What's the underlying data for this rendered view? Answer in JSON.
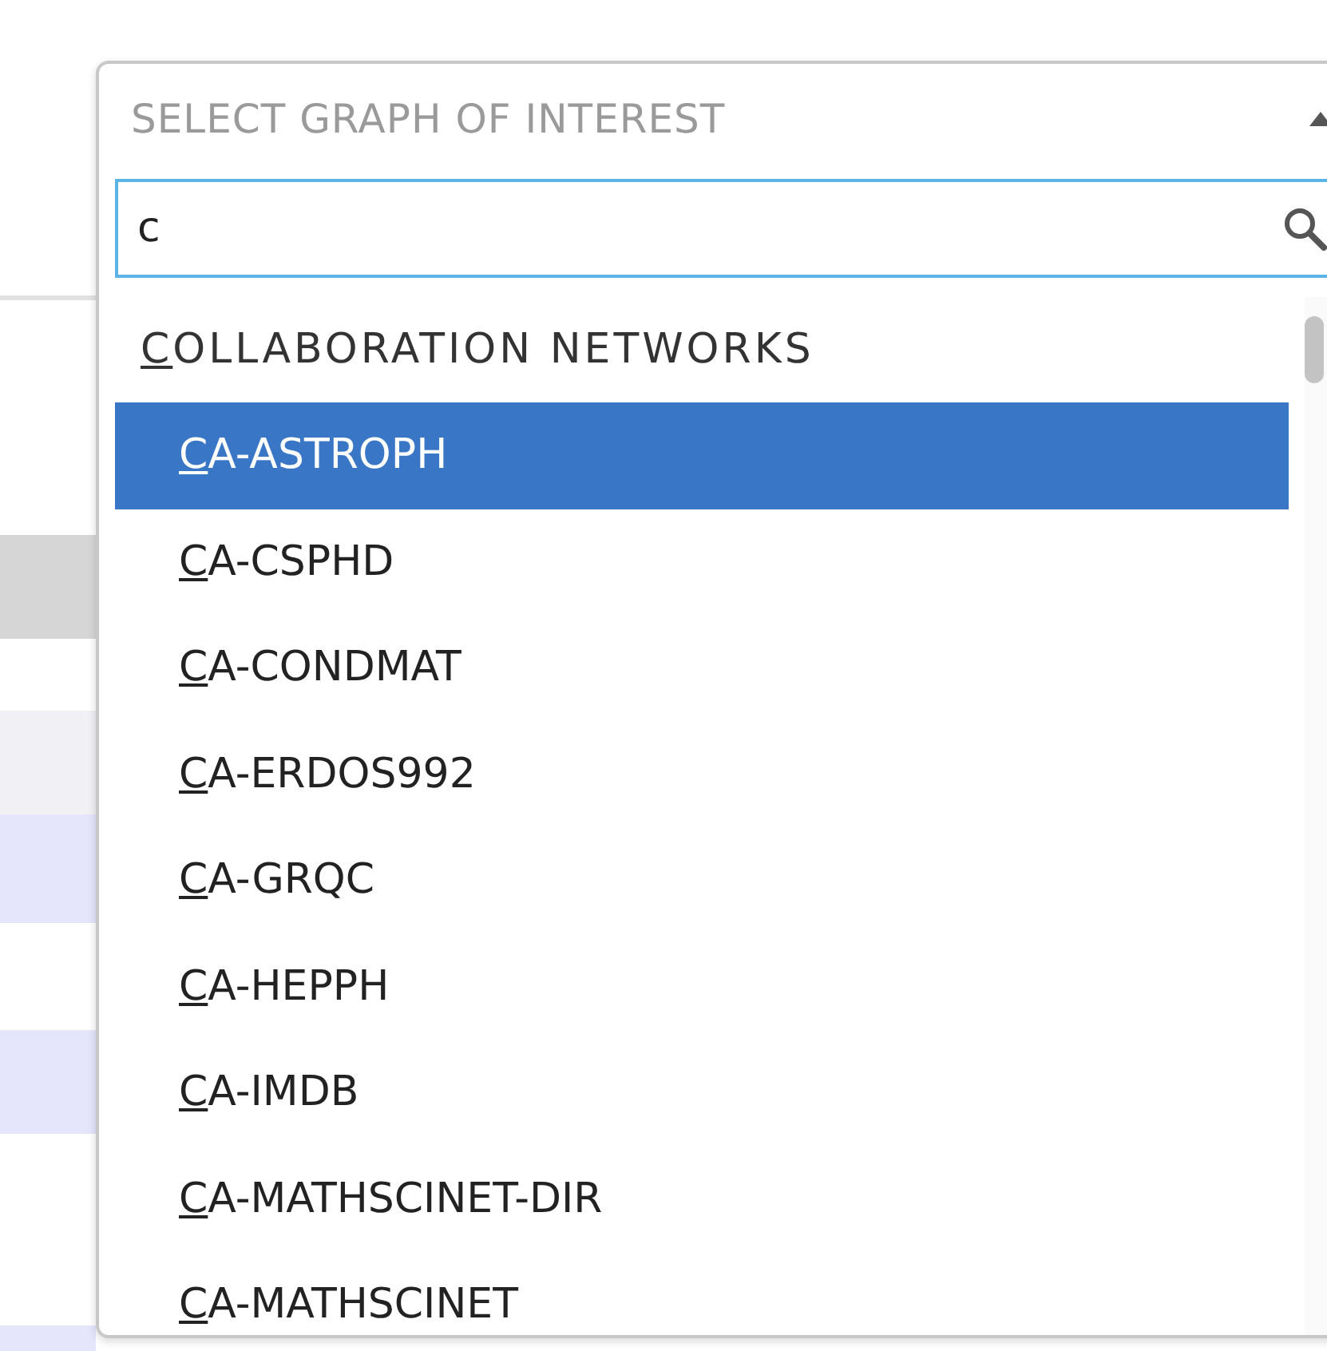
{
  "dropdown": {
    "placeholder": "SELECT GRAPH OF INTEREST",
    "expanded": true,
    "search": {
      "value": "c"
    },
    "groups": [
      {
        "label": {
          "match": "C",
          "rest": "OLLABORATION NETWORKS"
        },
        "items": [
          {
            "match": "C",
            "rest": "A-ASTROPH",
            "selected": true
          },
          {
            "match": "C",
            "rest": "A-CSPHD",
            "selected": false
          },
          {
            "match": "C",
            "rest": "A-CONDMAT",
            "selected": false
          },
          {
            "match": "C",
            "rest": "A-ERDOS992",
            "selected": false
          },
          {
            "match": "C",
            "rest": "A-GRQC",
            "selected": false
          },
          {
            "match": "C",
            "rest": "A-HEPPH",
            "selected": false
          },
          {
            "match": "C",
            "rest": "A-IMDB",
            "selected": false
          },
          {
            "match": "C",
            "rest": "A-MATHSCINET-DIR",
            "selected": false
          },
          {
            "match": "C",
            "rest": "A-MATHSCINET",
            "selected": false
          }
        ]
      }
    ]
  }
}
